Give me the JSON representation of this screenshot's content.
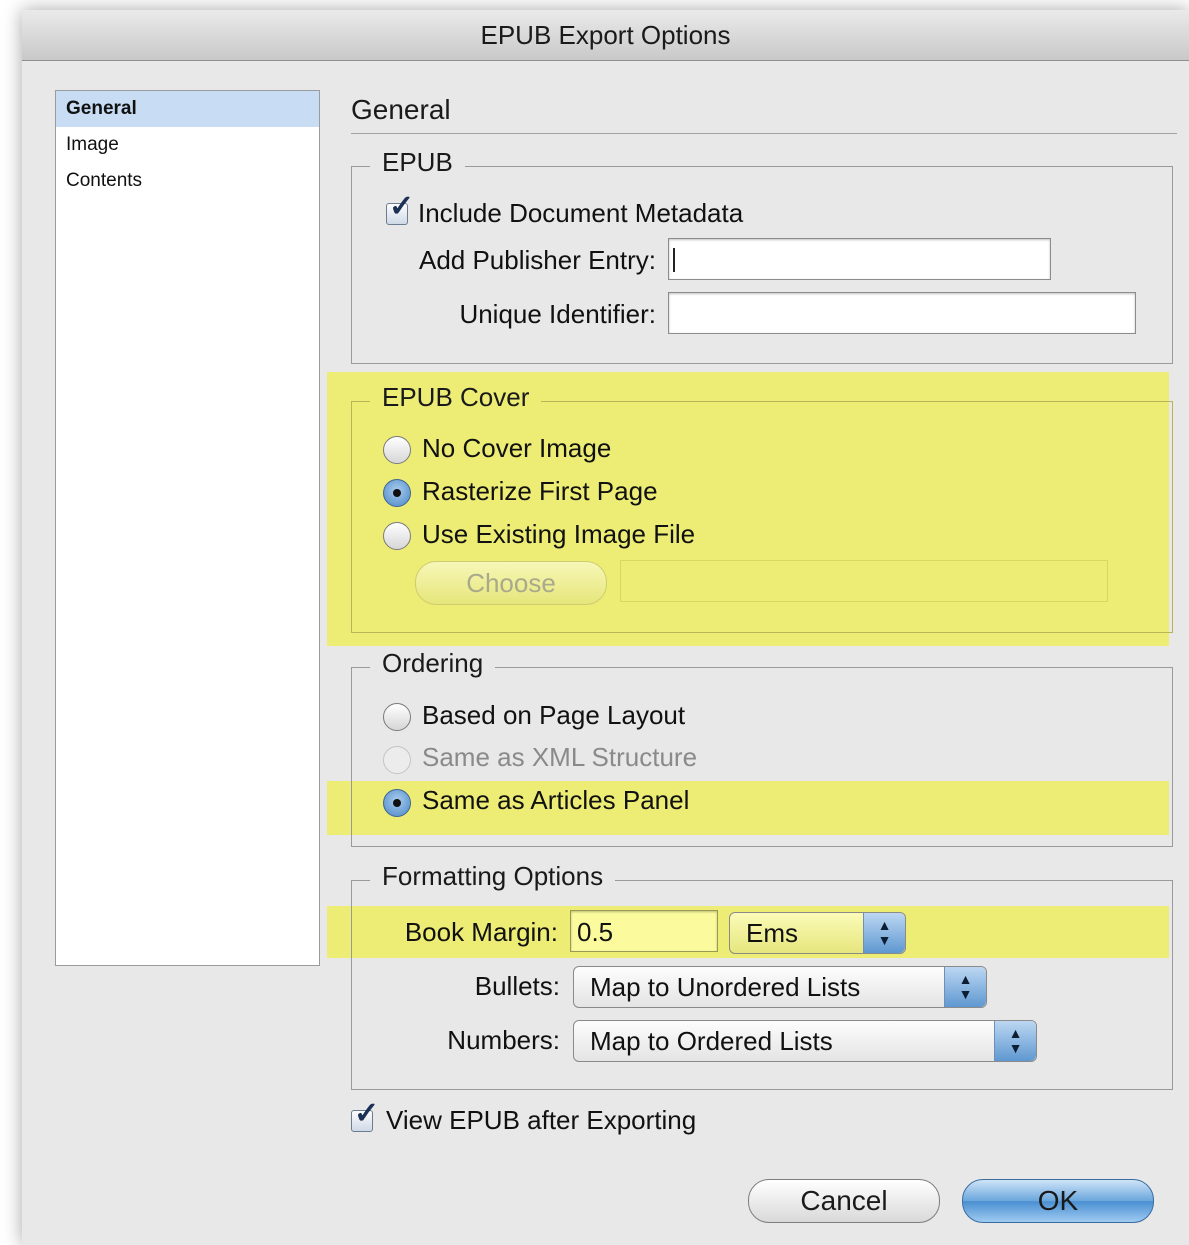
{
  "window": {
    "title": "EPUB Export Options"
  },
  "sidebar": {
    "items": [
      {
        "label": "General",
        "selected": true
      },
      {
        "label": "Image",
        "selected": false
      },
      {
        "label": "Contents",
        "selected": false
      }
    ]
  },
  "section_title": "General",
  "epub_group": {
    "label": "EPUB",
    "include_metadata": {
      "label": "Include Document Metadata",
      "checked": true
    },
    "publisher": {
      "label": "Add Publisher Entry:",
      "value": ""
    },
    "identifier": {
      "label": "Unique Identifier:",
      "value": ""
    }
  },
  "cover_group": {
    "label": "EPUB Cover",
    "options": [
      {
        "label": "No Cover Image",
        "selected": false
      },
      {
        "label": "Rasterize First Page",
        "selected": true
      },
      {
        "label": "Use Existing Image File",
        "selected": false
      }
    ],
    "choose_label": "Choose",
    "file_path": ""
  },
  "ordering_group": {
    "label": "Ordering",
    "options": [
      {
        "label": "Based on Page Layout",
        "selected": false,
        "enabled": true
      },
      {
        "label": "Same as XML Structure",
        "selected": false,
        "enabled": false
      },
      {
        "label": "Same as Articles Panel",
        "selected": true,
        "enabled": true
      }
    ]
  },
  "formatting_group": {
    "label": "Formatting Options",
    "book_margin": {
      "label": "Book Margin:",
      "value": "0.5",
      "unit": "Ems"
    },
    "bullets": {
      "label": "Bullets:",
      "value": "Map to Unordered Lists"
    },
    "numbers": {
      "label": "Numbers:",
      "value": "Map to Ordered Lists"
    }
  },
  "view_after": {
    "label": "View EPUB after Exporting",
    "checked": true
  },
  "buttons": {
    "cancel": "Cancel",
    "ok": "OK"
  },
  "colors": {
    "highlight": "#eded75",
    "selection": "#c8dcf4",
    "default_button": "#4a8fd1"
  }
}
